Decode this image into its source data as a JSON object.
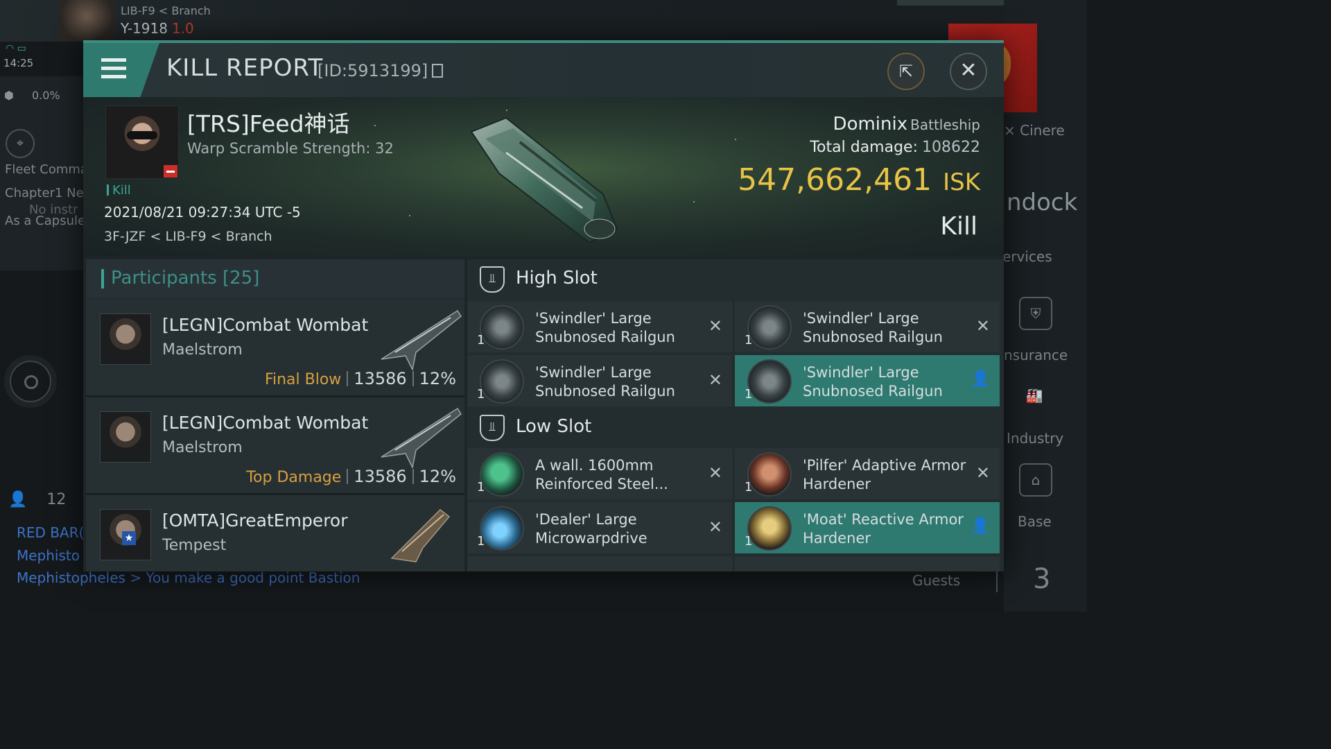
{
  "background": {
    "location_path": "LIB-F9 < Branch",
    "system_name": "Y-1918",
    "security": "1.0",
    "clock": "14:25",
    "cargo_percent": "0.0%",
    "left_lines": [
      "Fleet Comma",
      "Chapter1 Ne",
      "No instr",
      "As a Capsule"
    ],
    "local_count": "12",
    "chat_lines": [
      "RED BAR(",
      "Mephisto",
      "Mephistopheles"
    ],
    "chat_message": "> You make a good point Bastion",
    "right_labels": [
      "Cinere",
      "ndock",
      "ervices",
      "nsurance",
      "Industry",
      "Base"
    ],
    "guests_label": "Guests",
    "guests_count": "3"
  },
  "header": {
    "title": "KILL REPORT",
    "report_id": "[ID:5913199]"
  },
  "victim": {
    "name": "[TRS]Feed神话",
    "warp_scramble": "Warp Scramble Strength: 32",
    "kill_tag": "Kill",
    "datetime": "2021/08/21 09:27:34 UTC -5",
    "location": "3F-JZF < LIB-F9 < Branch",
    "ship_name": "Dominix",
    "ship_class": "Battleship",
    "total_damage_label": "Total damage:",
    "total_damage": "108622",
    "isk_value": "547,662,461",
    "isk_unit": "ISK",
    "result": "Kill"
  },
  "participants": {
    "title": "Participants [25]",
    "rows": [
      {
        "name": "[LEGN]Combat Wombat",
        "ship": "Maelstrom",
        "label": "Final Blow",
        "damage": "13586",
        "percent": "12%"
      },
      {
        "name": "[LEGN]Combat Wombat",
        "ship": "Maelstrom",
        "label": "Top Damage",
        "damage": "13586",
        "percent": "12%"
      },
      {
        "name": "[OMTA]GreatEmperor",
        "ship": "Tempest",
        "label": "",
        "damage": "",
        "percent": ""
      }
    ]
  },
  "slots": {
    "high_title": "High Slot",
    "low_title": "Low Slot",
    "high": [
      {
        "qty": "1",
        "name": "'Swindler' Large Snubnosed Railgun",
        "status": "destroyed"
      },
      {
        "qty": "1",
        "name": "'Swindler' Large Snubnosed Railgun",
        "status": "destroyed"
      },
      {
        "qty": "1",
        "name": "'Swindler' Large Snubnosed Railgun",
        "status": "destroyed"
      },
      {
        "qty": "1",
        "name": "'Swindler' Large Snubnosed Railgun",
        "status": "dropped"
      }
    ],
    "low": [
      {
        "qty": "1",
        "name": "A wall. 1600mm Reinforced Steel...",
        "status": "destroyed"
      },
      {
        "qty": "1",
        "name": "'Pilfer' Adaptive Armor Hardener",
        "status": "destroyed"
      },
      {
        "qty": "1",
        "name": "'Dealer' Large Microwarpdrive",
        "status": "destroyed"
      },
      {
        "qty": "1",
        "name": "'Moat' Reactive Armor Hardener",
        "status": "dropped"
      }
    ]
  },
  "icons": {
    "destroyed": "close-x",
    "dropped": "person"
  },
  "colors": {
    "accent": "#2e7a6e",
    "isk": "#e7c447",
    "final_blow": "#d8a040",
    "hostile_standing": "#c9302c",
    "chat_link": "#3d73c9"
  }
}
